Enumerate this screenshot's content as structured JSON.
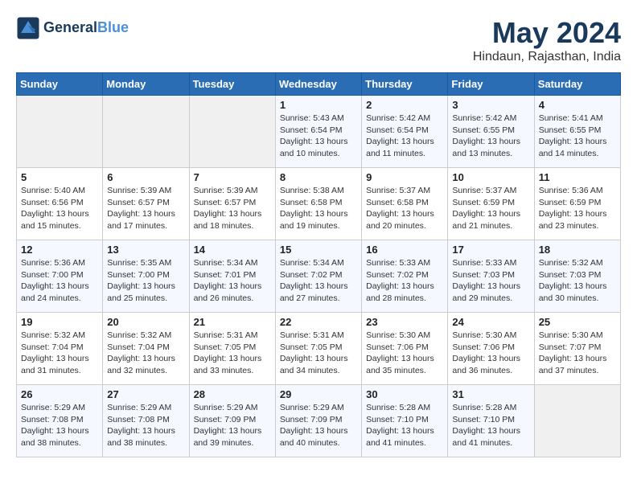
{
  "header": {
    "logo_line1": "General",
    "logo_line2": "Blue",
    "month_year": "May 2024",
    "location": "Hindaun, Rajasthan, India"
  },
  "weekdays": [
    "Sunday",
    "Monday",
    "Tuesday",
    "Wednesday",
    "Thursday",
    "Friday",
    "Saturday"
  ],
  "weeks": [
    [
      {
        "day": "",
        "info": ""
      },
      {
        "day": "",
        "info": ""
      },
      {
        "day": "",
        "info": ""
      },
      {
        "day": "1",
        "info": "Sunrise: 5:43 AM\nSunset: 6:54 PM\nDaylight: 13 hours\nand 10 minutes."
      },
      {
        "day": "2",
        "info": "Sunrise: 5:42 AM\nSunset: 6:54 PM\nDaylight: 13 hours\nand 11 minutes."
      },
      {
        "day": "3",
        "info": "Sunrise: 5:42 AM\nSunset: 6:55 PM\nDaylight: 13 hours\nand 13 minutes."
      },
      {
        "day": "4",
        "info": "Sunrise: 5:41 AM\nSunset: 6:55 PM\nDaylight: 13 hours\nand 14 minutes."
      }
    ],
    [
      {
        "day": "5",
        "info": "Sunrise: 5:40 AM\nSunset: 6:56 PM\nDaylight: 13 hours\nand 15 minutes."
      },
      {
        "day": "6",
        "info": "Sunrise: 5:39 AM\nSunset: 6:57 PM\nDaylight: 13 hours\nand 17 minutes."
      },
      {
        "day": "7",
        "info": "Sunrise: 5:39 AM\nSunset: 6:57 PM\nDaylight: 13 hours\nand 18 minutes."
      },
      {
        "day": "8",
        "info": "Sunrise: 5:38 AM\nSunset: 6:58 PM\nDaylight: 13 hours\nand 19 minutes."
      },
      {
        "day": "9",
        "info": "Sunrise: 5:37 AM\nSunset: 6:58 PM\nDaylight: 13 hours\nand 20 minutes."
      },
      {
        "day": "10",
        "info": "Sunrise: 5:37 AM\nSunset: 6:59 PM\nDaylight: 13 hours\nand 21 minutes."
      },
      {
        "day": "11",
        "info": "Sunrise: 5:36 AM\nSunset: 6:59 PM\nDaylight: 13 hours\nand 23 minutes."
      }
    ],
    [
      {
        "day": "12",
        "info": "Sunrise: 5:36 AM\nSunset: 7:00 PM\nDaylight: 13 hours\nand 24 minutes."
      },
      {
        "day": "13",
        "info": "Sunrise: 5:35 AM\nSunset: 7:00 PM\nDaylight: 13 hours\nand 25 minutes."
      },
      {
        "day": "14",
        "info": "Sunrise: 5:34 AM\nSunset: 7:01 PM\nDaylight: 13 hours\nand 26 minutes."
      },
      {
        "day": "15",
        "info": "Sunrise: 5:34 AM\nSunset: 7:02 PM\nDaylight: 13 hours\nand 27 minutes."
      },
      {
        "day": "16",
        "info": "Sunrise: 5:33 AM\nSunset: 7:02 PM\nDaylight: 13 hours\nand 28 minutes."
      },
      {
        "day": "17",
        "info": "Sunrise: 5:33 AM\nSunset: 7:03 PM\nDaylight: 13 hours\nand 29 minutes."
      },
      {
        "day": "18",
        "info": "Sunrise: 5:32 AM\nSunset: 7:03 PM\nDaylight: 13 hours\nand 30 minutes."
      }
    ],
    [
      {
        "day": "19",
        "info": "Sunrise: 5:32 AM\nSunset: 7:04 PM\nDaylight: 13 hours\nand 31 minutes."
      },
      {
        "day": "20",
        "info": "Sunrise: 5:32 AM\nSunset: 7:04 PM\nDaylight: 13 hours\nand 32 minutes."
      },
      {
        "day": "21",
        "info": "Sunrise: 5:31 AM\nSunset: 7:05 PM\nDaylight: 13 hours\nand 33 minutes."
      },
      {
        "day": "22",
        "info": "Sunrise: 5:31 AM\nSunset: 7:05 PM\nDaylight: 13 hours\nand 34 minutes."
      },
      {
        "day": "23",
        "info": "Sunrise: 5:30 AM\nSunset: 7:06 PM\nDaylight: 13 hours\nand 35 minutes."
      },
      {
        "day": "24",
        "info": "Sunrise: 5:30 AM\nSunset: 7:06 PM\nDaylight: 13 hours\nand 36 minutes."
      },
      {
        "day": "25",
        "info": "Sunrise: 5:30 AM\nSunset: 7:07 PM\nDaylight: 13 hours\nand 37 minutes."
      }
    ],
    [
      {
        "day": "26",
        "info": "Sunrise: 5:29 AM\nSunset: 7:08 PM\nDaylight: 13 hours\nand 38 minutes."
      },
      {
        "day": "27",
        "info": "Sunrise: 5:29 AM\nSunset: 7:08 PM\nDaylight: 13 hours\nand 38 minutes."
      },
      {
        "day": "28",
        "info": "Sunrise: 5:29 AM\nSunset: 7:09 PM\nDaylight: 13 hours\nand 39 minutes."
      },
      {
        "day": "29",
        "info": "Sunrise: 5:29 AM\nSunset: 7:09 PM\nDaylight: 13 hours\nand 40 minutes."
      },
      {
        "day": "30",
        "info": "Sunrise: 5:28 AM\nSunset: 7:10 PM\nDaylight: 13 hours\nand 41 minutes."
      },
      {
        "day": "31",
        "info": "Sunrise: 5:28 AM\nSunset: 7:10 PM\nDaylight: 13 hours\nand 41 minutes."
      },
      {
        "day": "",
        "info": ""
      }
    ]
  ]
}
